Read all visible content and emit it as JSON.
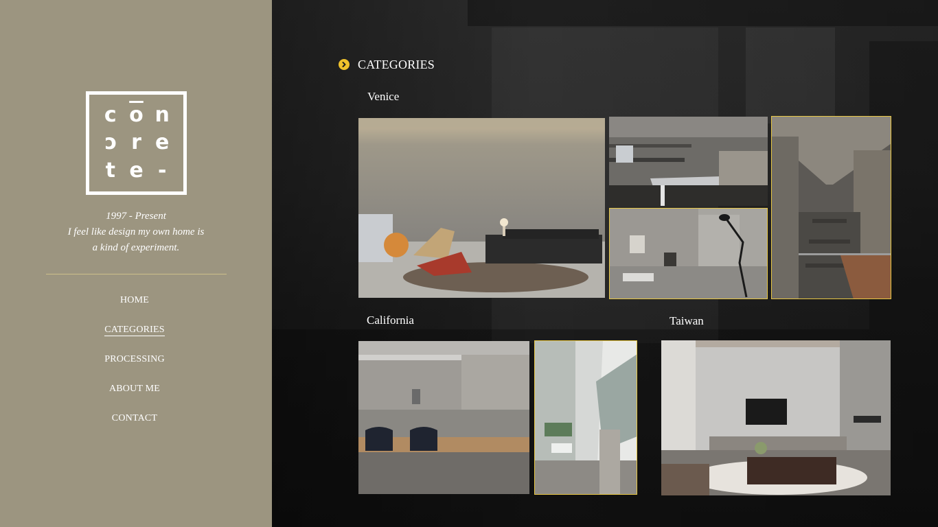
{
  "brand": {
    "logo_letters": [
      "c",
      "o",
      "n",
      "c",
      "r",
      "e",
      "t",
      "e",
      "-"
    ],
    "tagline_lines": [
      "1997 - Present",
      "I feel like design my own home is",
      "a kind of experiment."
    ]
  },
  "nav": {
    "items": [
      {
        "label": "HOME"
      },
      {
        "label": "CATEGORIES",
        "active": true
      },
      {
        "label": "PROCESSING"
      },
      {
        "label": "ABOUT ME"
      },
      {
        "label": "CONTACT"
      }
    ]
  },
  "main": {
    "section_title": "CATEGORIES",
    "groups": [
      {
        "label": "Venice"
      },
      {
        "label": "California"
      },
      {
        "label": "Taiwan"
      }
    ]
  },
  "colors": {
    "sidebar_bg": "#9c9580",
    "accent": "#f0c22c",
    "highlight_border": "#e9c845",
    "text": "#ffffff"
  },
  "icons": [
    "chevron-circle-right-icon"
  ]
}
